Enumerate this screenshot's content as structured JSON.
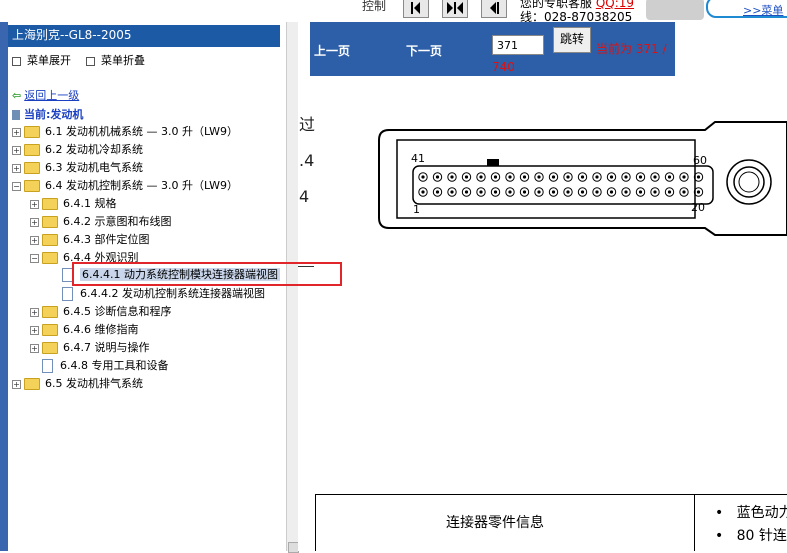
{
  "top": {
    "control_label": "控制",
    "service_line1": "您的专职客服 ",
    "service_qq": "QQ:19",
    "service_line2": "线：028-87038205",
    "menu_link": ">>菜单"
  },
  "sidebar": {
    "title": "上海别克--GL8--2005",
    "expand_all": "菜单展开",
    "collapse_all": "菜单折叠",
    "back": "返回上一级",
    "current": "当前:发动机",
    "tree": [
      {
        "label": "6.1 发动机机械系统 — 3.0 升（LW9）",
        "type": "folder",
        "expander": "+"
      },
      {
        "label": "6.2 发动机冷却系统",
        "type": "folder",
        "expander": "+"
      },
      {
        "label": "6.3 发动机电气系统",
        "type": "folder",
        "expander": "+"
      },
      {
        "label": "6.4 发动机控制系统 — 3.0 升（LW9）",
        "type": "folder",
        "expander": "−"
      },
      {
        "label": "6.4.1 规格",
        "type": "folder",
        "expander": "+"
      },
      {
        "label": "6.4.2 示意图和布线图",
        "type": "folder",
        "expander": "+"
      },
      {
        "label": "6.4.3 部件定位图",
        "type": "folder",
        "expander": "+"
      },
      {
        "label": "6.4.4 外观识别",
        "type": "folder",
        "expander": "−"
      },
      {
        "label": "6.4.4.1 动力系统控制模块连接器端视图",
        "type": "doc",
        "expander": ""
      },
      {
        "label": "6.4.4.2 发动机控制系统连接器端视图",
        "type": "doc",
        "expander": ""
      },
      {
        "label": "6.4.5 诊断信息和程序",
        "type": "folder",
        "expander": "+"
      },
      {
        "label": "6.4.6 维修指南",
        "type": "folder",
        "expander": "+"
      },
      {
        "label": "6.4.7 说明与操作",
        "type": "folder",
        "expander": "+"
      },
      {
        "label": "6.4.8 专用工具和设备",
        "type": "doc",
        "expander": ""
      },
      {
        "label": "6.5 发动机排气系统",
        "type": "folder",
        "expander": "+"
      }
    ]
  },
  "nav": {
    "prev": "上一页",
    "next": "下一页",
    "page_value": "371",
    "jump": "跳转",
    "status_line1": "当前为 371 /",
    "status_line2": "740"
  },
  "content": {
    "side_frag1": "过",
    "side_frag2": ".4",
    "side_frag3": "4",
    "pin_41": "41",
    "pin_60": "60",
    "pin_1": "1",
    "pin_20": "20",
    "connector_info": "连接器零件信息",
    "bullet1": "蓝色动力",
    "bullet2": "80 针连"
  },
  "colors": {
    "nav_blue": "#2d5fa8",
    "title_blue": "#1c5aa6",
    "highlight_red": "#e0262a",
    "status_red": "#e01010",
    "link_blue": "#1a3fc0"
  }
}
